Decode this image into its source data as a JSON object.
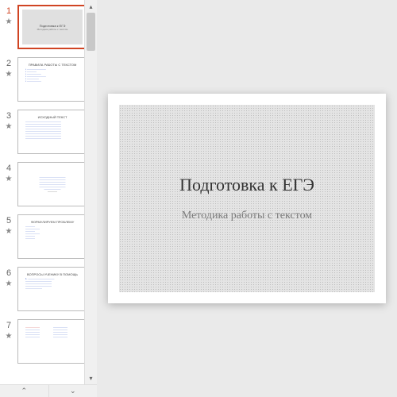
{
  "selected_slide": 1,
  "slides": [
    {
      "num": "1",
      "title": "Подготовка к ЕГЭ",
      "sub": "Методика работы с текстом",
      "layout": "title"
    },
    {
      "num": "2",
      "title": "ПРАВИЛА РАБОТЫ С ТЕКСТОМ",
      "layout": "bullets"
    },
    {
      "num": "3",
      "title": "ИСХОДНЫЙ ТЕКСТ",
      "layout": "paragraph-blue"
    },
    {
      "num": "4",
      "title": "",
      "layout": "paragraph-blue-center"
    },
    {
      "num": "5",
      "title": "ФОРМУЛИРУЕМ ПРОБЛЕМУ",
      "layout": "bullets-small"
    },
    {
      "num": "6",
      "title": "ВОПРОСЫ УЧЕНИКУ В ПОМОЩЬ",
      "layout": "bullets-black"
    },
    {
      "num": "7",
      "title": "",
      "layout": "two-col"
    }
  ],
  "main_slide": {
    "title": "Подготовка к ЕГЭ",
    "subtitle": "Методика работы с текстом"
  },
  "icons": {
    "star": "★",
    "up": "▴",
    "down": "▾",
    "dup": "⎘",
    "ddown": "⎗"
  }
}
